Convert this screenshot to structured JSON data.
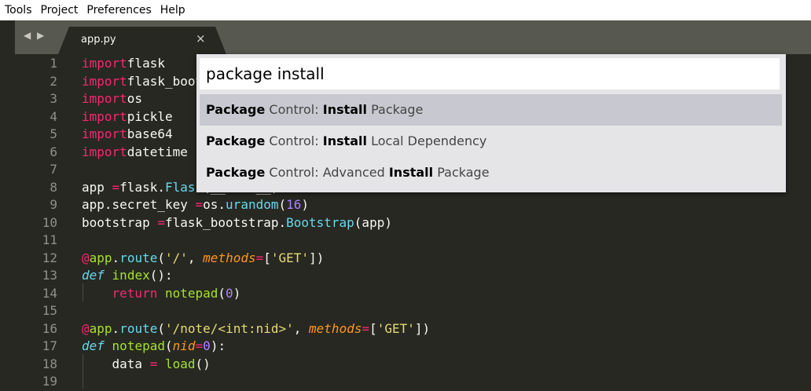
{
  "menu": [
    "Tools",
    "Project",
    "Preferences",
    "Help"
  ],
  "nav_arrows": "◀ ▶",
  "tab": {
    "title": "app.py",
    "close": "×"
  },
  "palette": {
    "query": "package install",
    "items": [
      {
        "segments": [
          {
            "t": "Package",
            "b": true
          },
          {
            "t": " Control: ",
            "b": false
          },
          {
            "t": "Install",
            "b": true
          },
          {
            "t": " Package",
            "b": false
          }
        ],
        "selected": true
      },
      {
        "segments": [
          {
            "t": "Package",
            "b": true
          },
          {
            "t": " Control: ",
            "b": false
          },
          {
            "t": "Install",
            "b": true
          },
          {
            "t": " Local Dependency",
            "b": false
          }
        ],
        "selected": false
      },
      {
        "segments": [
          {
            "t": "Package",
            "b": true
          },
          {
            "t": " Control: Advanced ",
            "b": false
          },
          {
            "t": "Install",
            "b": true
          },
          {
            "t": " Package",
            "b": false
          }
        ],
        "selected": false
      }
    ]
  },
  "lines": [
    [
      [
        "k",
        "import"
      ],
      [
        "",
        "flask"
      ]
    ],
    [
      [
        "k",
        "import"
      ],
      [
        "",
        "flask_bootstrap"
      ]
    ],
    [
      [
        "k",
        "import"
      ],
      [
        "",
        "os"
      ]
    ],
    [
      [
        "k",
        "import"
      ],
      [
        "",
        "pickle"
      ]
    ],
    [
      [
        "k",
        "import"
      ],
      [
        "",
        "base64"
      ]
    ],
    [
      [
        "k",
        "import"
      ],
      [
        "",
        "datetime"
      ]
    ],
    [],
    [
      [
        "",
        "app "
      ],
      [
        "k",
        "="
      ],
      [
        "",
        "flask."
      ],
      [
        "f",
        "Flask"
      ],
      [
        "",
        "(__name__)"
      ]
    ],
    [
      [
        "",
        "app.secret_key "
      ],
      [
        "k",
        "="
      ],
      [
        "",
        "os."
      ],
      [
        "f",
        "urandom"
      ],
      [
        "",
        "("
      ],
      [
        "n",
        "16"
      ],
      [
        "",
        ")"
      ]
    ],
    [
      [
        "",
        "bootstrap "
      ],
      [
        "k",
        "="
      ],
      [
        "",
        "flask_bootstrap."
      ],
      [
        "f",
        "Bootstrap"
      ],
      [
        "",
        "(app)"
      ]
    ],
    [],
    [
      [
        "k",
        "@"
      ],
      [
        "fn",
        "app"
      ],
      [
        "",
        "."
      ],
      [
        "f",
        "route"
      ],
      [
        "",
        "("
      ],
      [
        "s",
        "'/'"
      ],
      [
        "",
        ", "
      ],
      [
        "p",
        "methods"
      ],
      [
        "k",
        "="
      ],
      [
        "",
        "["
      ],
      [
        "s",
        "'GET'"
      ],
      [
        "",
        "])"
      ]
    ],
    [
      [
        "d",
        "def"
      ],
      [
        "",
        " "
      ],
      [
        "fn",
        "index"
      ],
      [
        "",
        "():"
      ]
    ],
    [
      [
        "",
        "    "
      ],
      [
        "k",
        "return"
      ],
      [
        "",
        " "
      ],
      [
        "fn",
        "notepad"
      ],
      [
        "",
        "("
      ],
      [
        "n",
        "0"
      ],
      [
        "",
        ")"
      ]
    ],
    [],
    [
      [
        "k",
        "@"
      ],
      [
        "fn",
        "app"
      ],
      [
        "",
        "."
      ],
      [
        "f",
        "route"
      ],
      [
        "",
        "("
      ],
      [
        "s",
        "'/note/<int:nid>'"
      ],
      [
        "",
        ", "
      ],
      [
        "p",
        "methods"
      ],
      [
        "k",
        "="
      ],
      [
        "",
        "["
      ],
      [
        "s",
        "'GET'"
      ],
      [
        "",
        "])"
      ]
    ],
    [
      [
        "d",
        "def"
      ],
      [
        "",
        " "
      ],
      [
        "fn",
        "notepad"
      ],
      [
        "",
        "("
      ],
      [
        "p",
        "nid"
      ],
      [
        "k",
        "="
      ],
      [
        "n",
        "0"
      ],
      [
        "",
        "):"
      ]
    ],
    [
      [
        "",
        "    data "
      ],
      [
        "k",
        "="
      ],
      [
        "",
        " "
      ],
      [
        "fn",
        "load"
      ],
      [
        "",
        "()"
      ]
    ],
    []
  ],
  "line_numbers": [
    "1",
    "2",
    "3",
    "4",
    "5",
    "6",
    "7",
    "8",
    "9",
    "10",
    "11",
    "12",
    "13",
    "14",
    "15",
    "16",
    "17",
    "18",
    "19"
  ]
}
